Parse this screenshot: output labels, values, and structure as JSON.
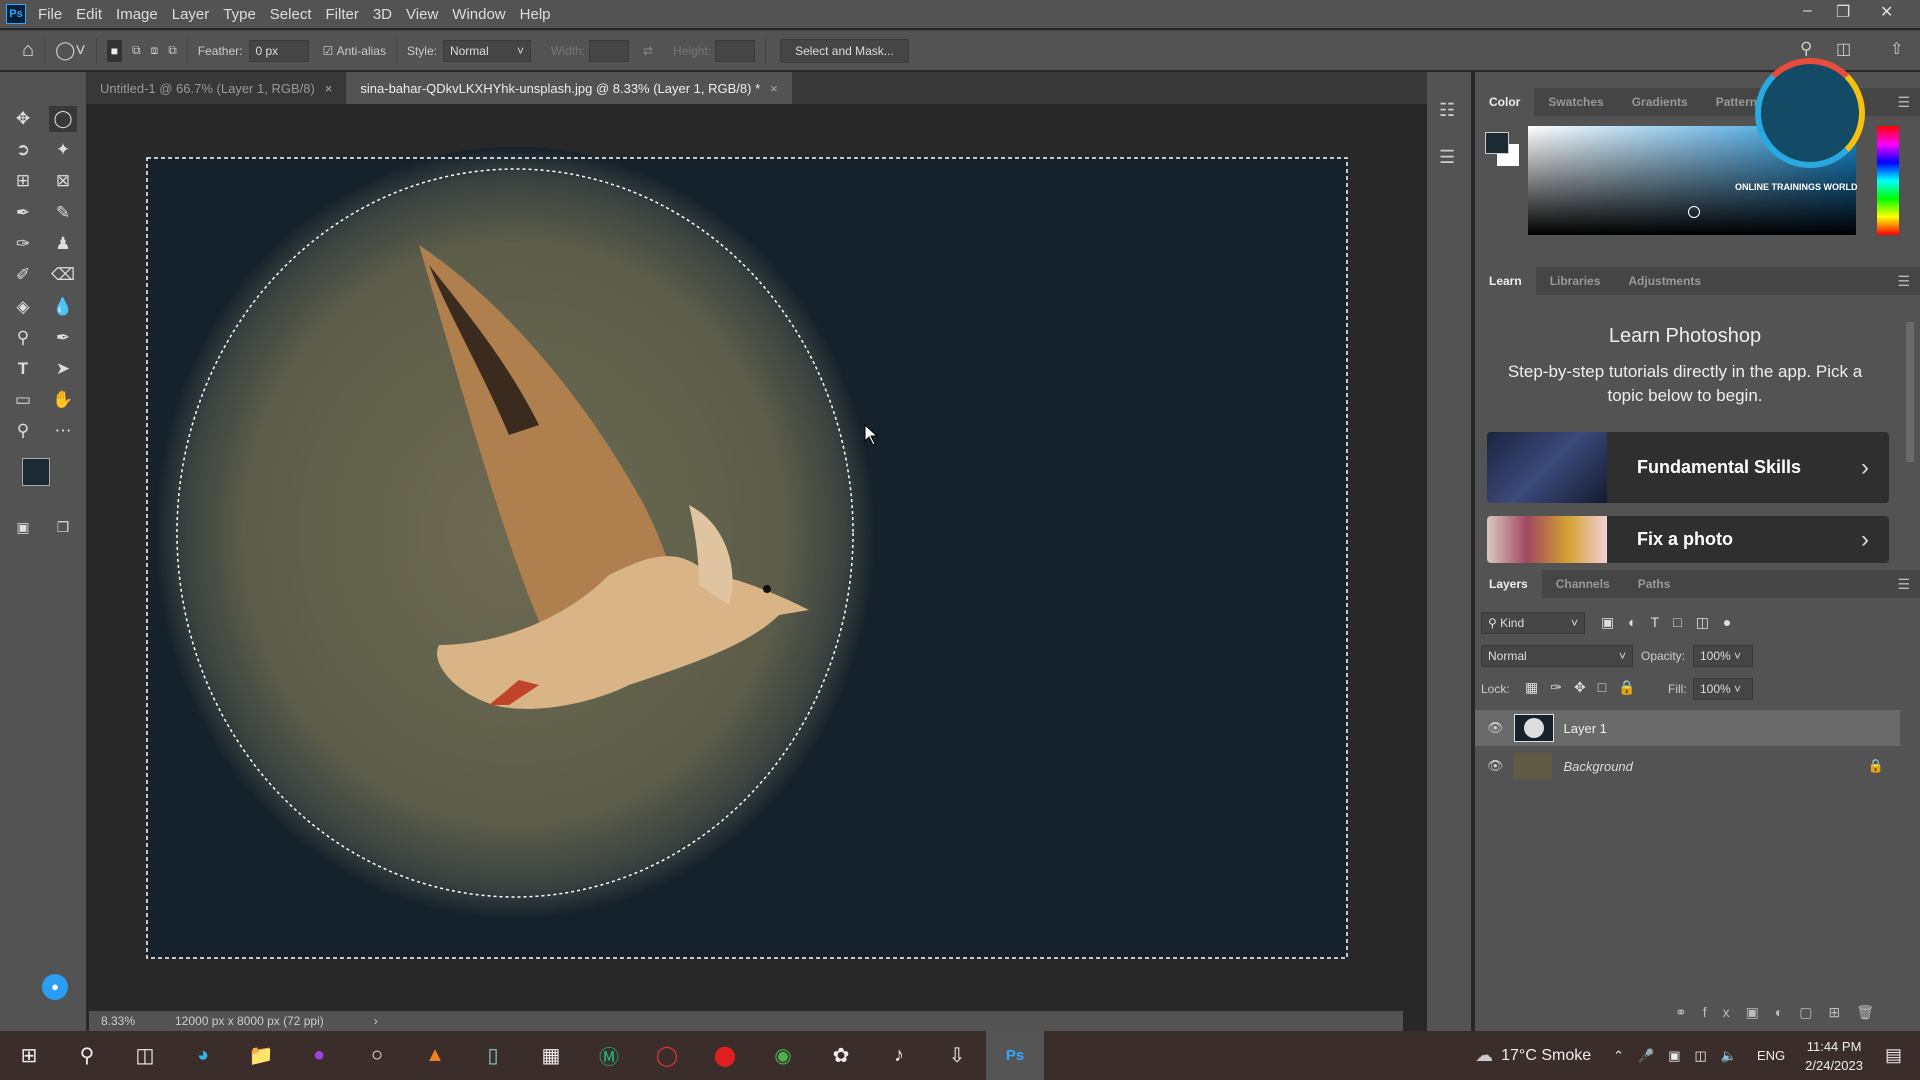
{
  "app": {
    "logo": "Ps",
    "menu": [
      "File",
      "Edit",
      "Image",
      "Layer",
      "Type",
      "Select",
      "Filter",
      "3D",
      "View",
      "Window",
      "Help"
    ]
  },
  "options": {
    "feather_label": "Feather:",
    "feather_value": "0 px",
    "antialias_label": "Anti-alias",
    "antialias_checked": true,
    "style_label": "Style:",
    "style_value": "Normal",
    "width_label": "Width:",
    "height_label": "Height:",
    "select_mask": "Select and Mask..."
  },
  "tabs": [
    {
      "label": "Untitled-1 @ 66.7% (Layer 1, RGB/8)",
      "active": false
    },
    {
      "label": "sina-bahar-QDkvLKXHYhk-unsplash.jpg @ 8.33% (Layer 1, RGB/8) *",
      "active": true
    }
  ],
  "status": {
    "zoom": "8.33%",
    "doc": "12000 px x 8000 px (72 ppi)"
  },
  "color_panel": {
    "tabs": [
      "Color",
      "Swatches",
      "Gradients",
      "Patterns"
    ],
    "foreground": "#1b2a33",
    "background": "#ffffff",
    "watermark": "ONLINE TRAININGS WORLD"
  },
  "learn_panel": {
    "tabs": [
      "Learn",
      "Libraries",
      "Adjustments"
    ],
    "title": "Learn Photoshop",
    "subtitle": "Step-by-step tutorials directly in the app. Pick a topic below to begin.",
    "cards": [
      "Fundamental Skills",
      "Fix a photo"
    ]
  },
  "layers_panel": {
    "tabs": [
      "Layers",
      "Channels",
      "Paths"
    ],
    "filter": "Kind",
    "blend": "Normal",
    "opacity_label": "Opacity:",
    "opacity": "100%",
    "lock_label": "Lock:",
    "fill_label": "Fill:",
    "fill": "100%",
    "layers": [
      {
        "name": "Layer 1",
        "selected": true
      },
      {
        "name": "Background",
        "locked": true
      }
    ]
  },
  "taskbar": {
    "weather": "17°C  Smoke",
    "lang": "ENG",
    "time": "11:44 PM",
    "date": "2/24/2023"
  },
  "colors": {
    "canvas": "#16222b",
    "ui": "#535353",
    "accent": "#31a8ff"
  }
}
